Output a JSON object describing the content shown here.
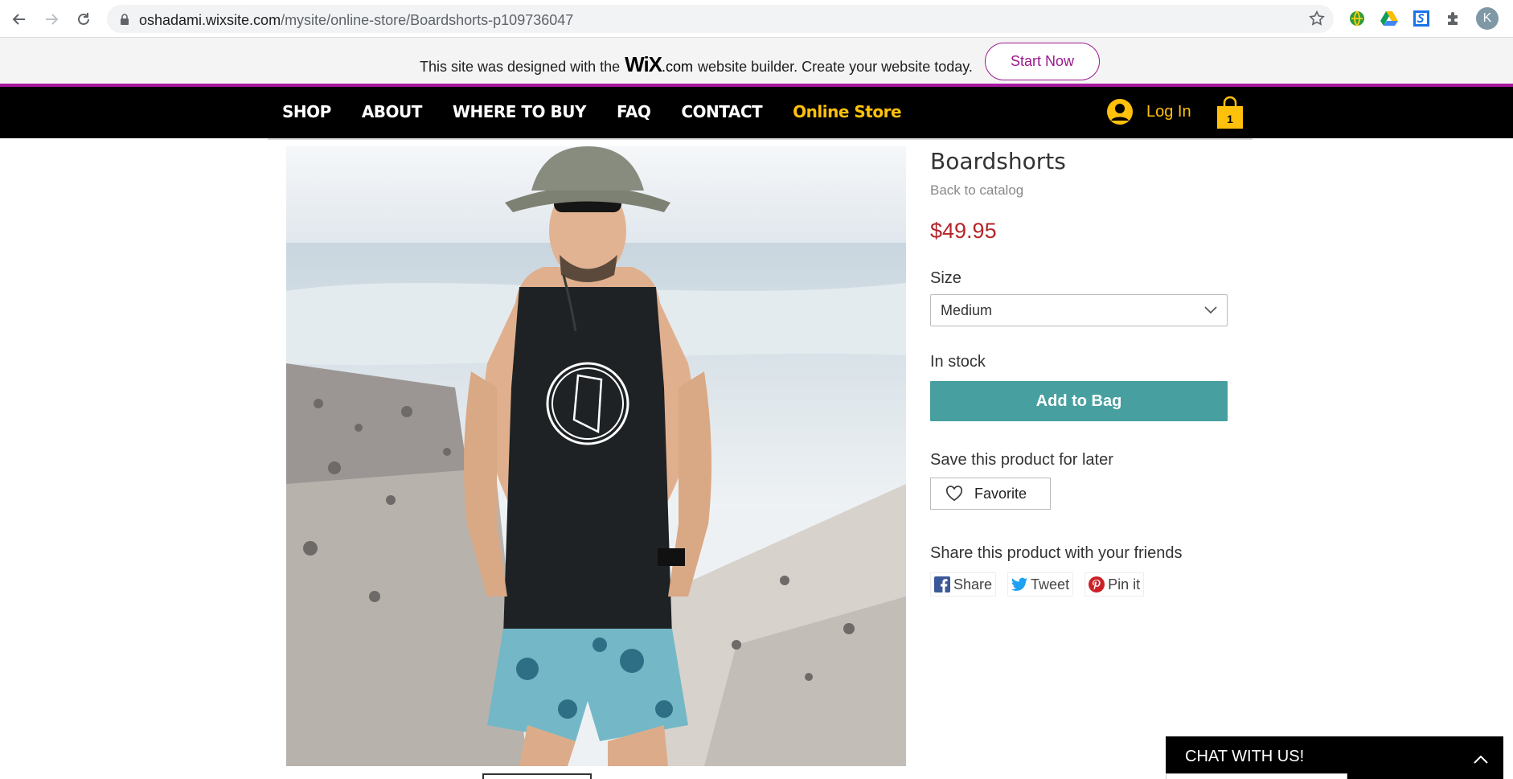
{
  "browser": {
    "url_host": "oshadami.wixsite.com",
    "url_path": "/mysite/online-store/Boardshorts-p109736047",
    "profile_initial": "K"
  },
  "wix_banner": {
    "text_before": "This site was designed with the",
    "logo_wix": "WiX",
    "logo_com": ".com",
    "text_after": "website builder. Create your website today.",
    "cta": "Start Now"
  },
  "nav": {
    "items": [
      {
        "label": "SHOP",
        "active": false
      },
      {
        "label": "ABOUT",
        "active": false
      },
      {
        "label": "WHERE TO BUY",
        "active": false
      },
      {
        "label": "FAQ",
        "active": false
      },
      {
        "label": "CONTACT",
        "active": false
      },
      {
        "label": "Online Store",
        "active": true
      }
    ],
    "login_label": "Log In",
    "cart_count": "1"
  },
  "product": {
    "title": "Boardshorts",
    "back_link": "Back to catalog",
    "price": "$49.95",
    "size_label": "Size",
    "size_selected": "Medium",
    "stock": "In stock",
    "add_button": "Add to Bag",
    "save_label": "Save this product for later",
    "favorite_button": "Favorite",
    "share_label": "Share this product with your friends",
    "share_buttons": {
      "facebook": "Share",
      "twitter": "Tweet",
      "pinterest": "Pin it"
    }
  },
  "chat": {
    "label": "CHAT WITH US!"
  },
  "colors": {
    "nav_bg": "#000000",
    "nav_accent": "#ffc10b",
    "wix_accent": "#9b1a8f",
    "add_to_bag": "#479fa0",
    "price": "#b3262a"
  }
}
